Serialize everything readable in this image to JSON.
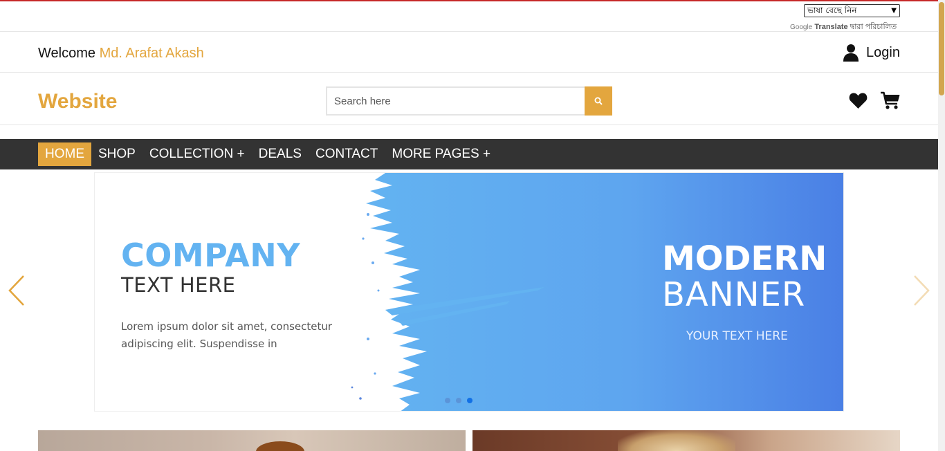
{
  "translate": {
    "select_value": "ভাষা বেছে নিন",
    "google_label": "Google",
    "translate_label": "Translate",
    "powered_suffix": "দ্বারা পরিচালিত"
  },
  "welcome": {
    "prefix": "Welcome",
    "user_name": "Md. Arafat Akash"
  },
  "login": {
    "label": "Login",
    "icon": "user-icon"
  },
  "header": {
    "logo": "Website",
    "search_placeholder": "Search here",
    "search_icon": "search-icon",
    "wishlist_icon": "heart-icon",
    "cart_icon": "cart-icon"
  },
  "nav": {
    "items": [
      {
        "label": "HOME"
      },
      {
        "label": "SHOP"
      },
      {
        "label": "COLLECTION +"
      },
      {
        "label": "DEALS"
      },
      {
        "label": "CONTACT"
      },
      {
        "label": "MORE PAGES +"
      }
    ],
    "active_index": 0
  },
  "banner": {
    "company": "COMPANY",
    "text_here": "TEXT HERE",
    "lorem": "Lorem ipsum dolor sit amet, consectetur adipiscing elit. Suspendisse in",
    "modern": "MODERN",
    "banner_word": "BANNER",
    "your_text": "YOUR TEXT HERE",
    "slide_count": 3,
    "active_slide": 3
  },
  "colors": {
    "accent": "#e3a63e",
    "nav_bg": "#333333",
    "banner_blue_light": "#63b3f1",
    "banner_blue_dark": "#4a7fe5"
  },
  "carousel": {
    "prev_icon": "chevron-left-icon",
    "next_icon": "chevron-right-icon"
  }
}
